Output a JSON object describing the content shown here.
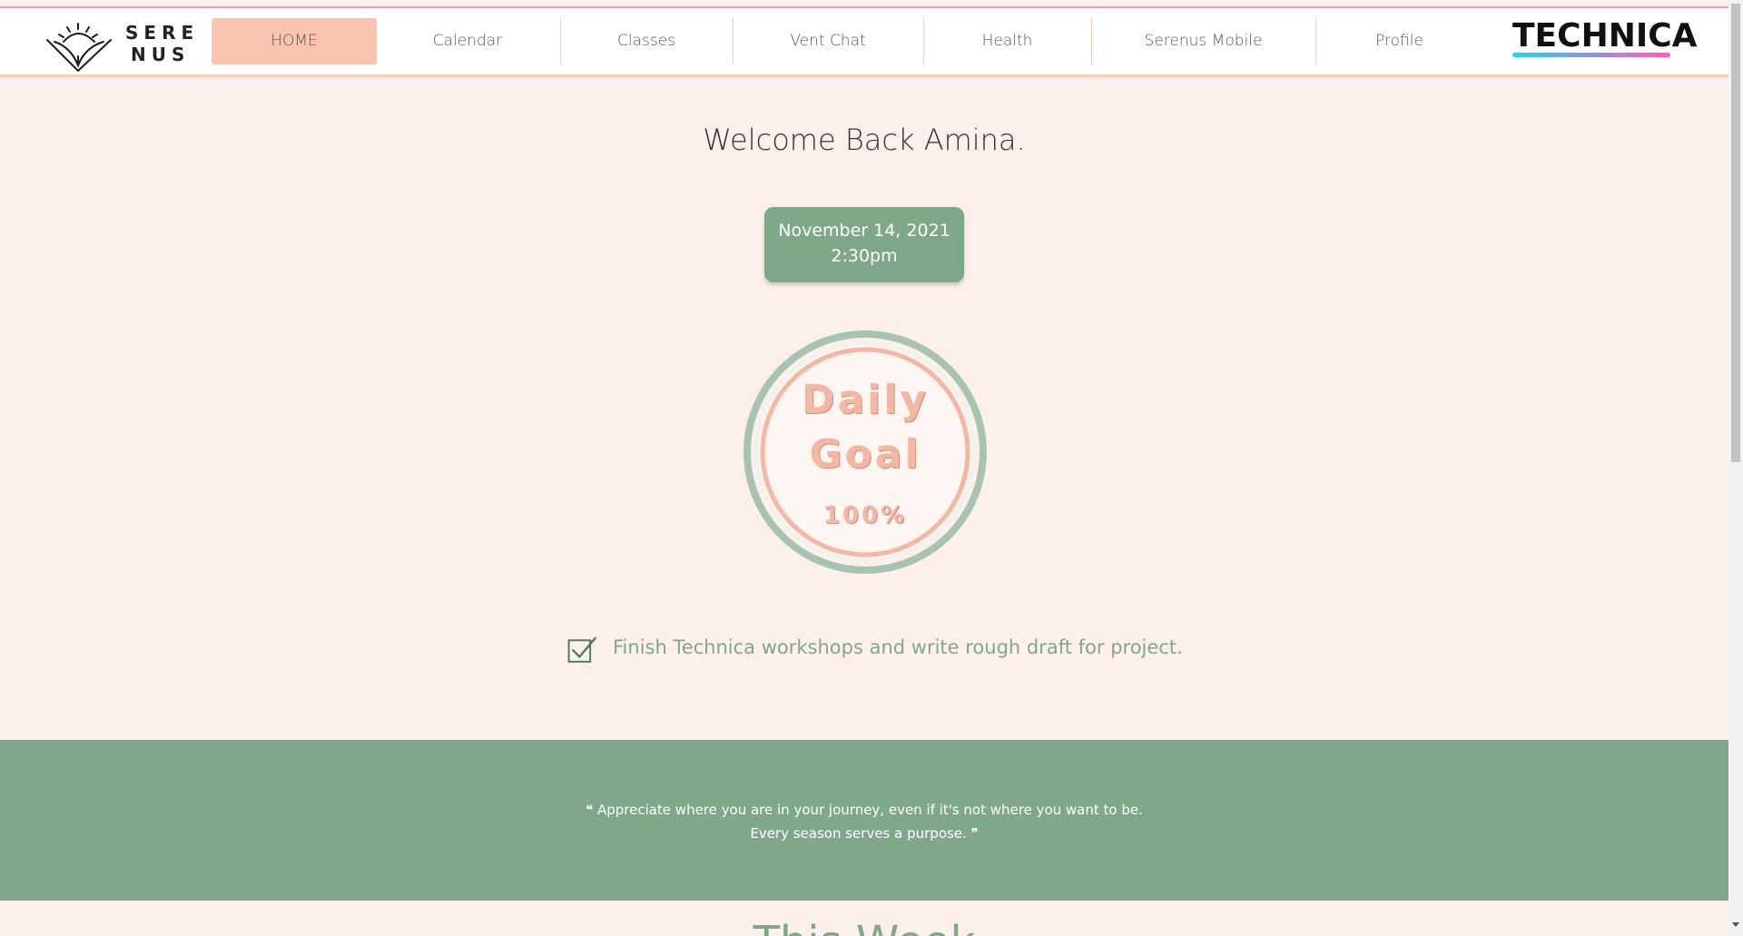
{
  "brand": {
    "name_line1": "SERE",
    "name_line2": "NUS",
    "partner": "TECHNICA"
  },
  "nav": {
    "items": [
      {
        "label": "HOME",
        "active": true
      },
      {
        "label": "Calendar"
      },
      {
        "label": "Classes"
      },
      {
        "label": "Vent Chat"
      },
      {
        "label": "Health"
      },
      {
        "label": "Serenus Mobile"
      },
      {
        "label": "Profile"
      }
    ]
  },
  "main": {
    "welcome": "Welcome Back Amina.",
    "date": "November 14, 2021",
    "time": "2:30pm",
    "goal": {
      "line1": "Daily",
      "line2": "Goal",
      "percent": "100%"
    },
    "task": {
      "text": "Finish Technica workshops and write rough draft for project.",
      "checked": true
    }
  },
  "quote": {
    "line1": "❝ Appreciate where you are in your journey, even if it's not where you want to be.",
    "line2": "Every season serves a purpose. ❞"
  },
  "section_title": "This Week",
  "colors": {
    "background": "#fdf0ec",
    "accent_green": "#7fa889",
    "accent_peach": "#f9c4b0",
    "header_line": "#e9a0b6"
  }
}
